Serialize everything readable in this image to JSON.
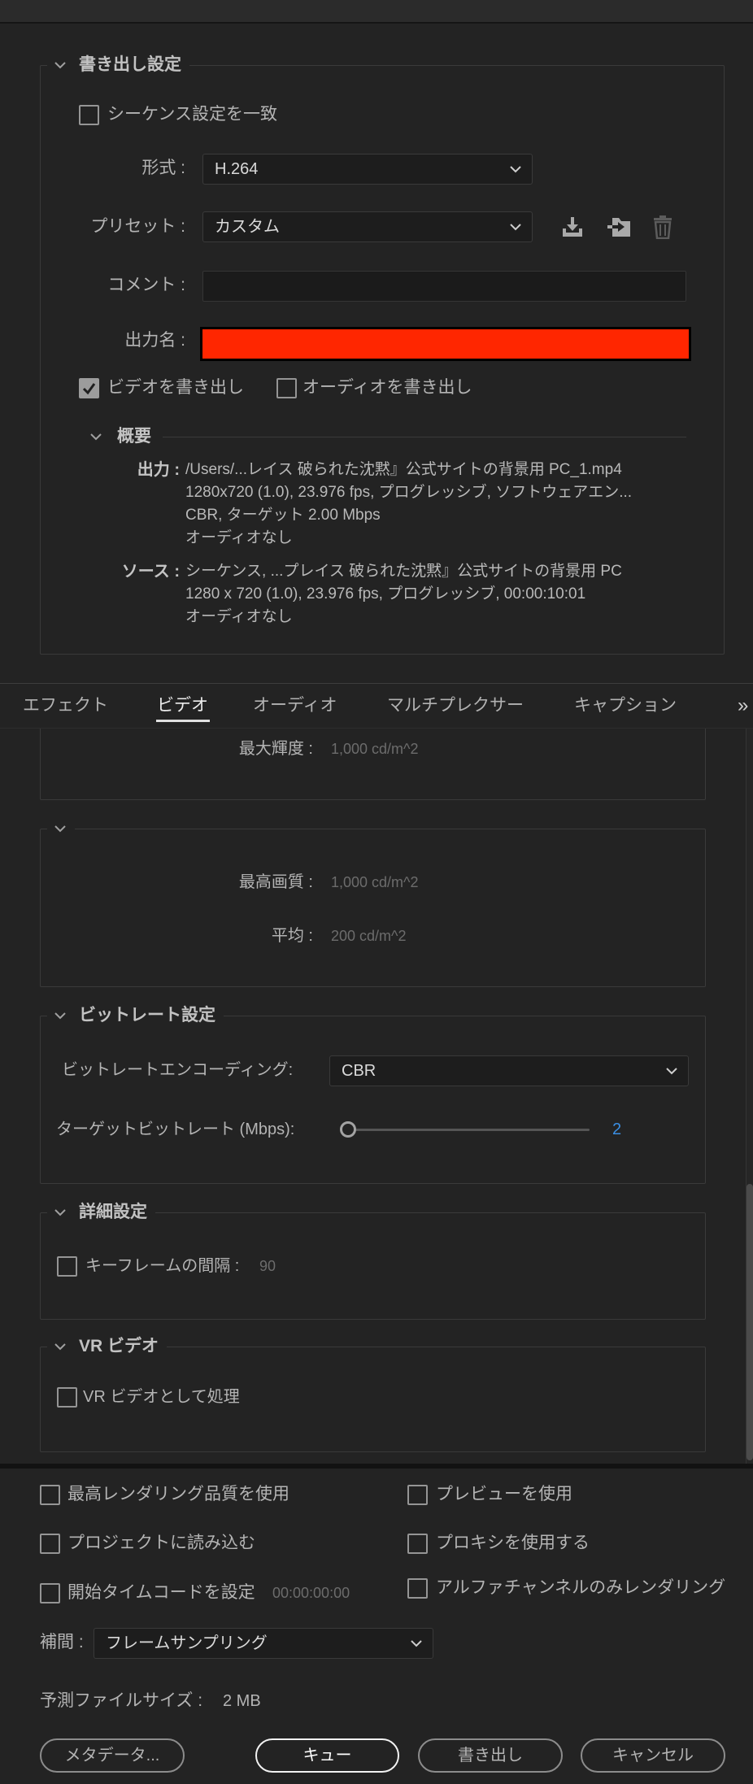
{
  "colors": {
    "output_name_fill": "#ff2600",
    "bitrate_value": "#3b8fe3",
    "active_tab_underline": "#e0e0e0"
  },
  "export_settings": {
    "title": "書き出し設定",
    "match_sequence": {
      "label": "シーケンス設定を一致",
      "checked": false
    },
    "format": {
      "label": "形式 :",
      "value": "H.264"
    },
    "preset": {
      "label": "プリセット :",
      "value": "カスタム",
      "icons": [
        "download-icon",
        "folder-import-icon",
        "trash-icon"
      ]
    },
    "comment": {
      "label": "コメント :"
    },
    "output_name": {
      "label": "出力名 :"
    },
    "export_video": {
      "label": "ビデオを書き出し",
      "checked": true
    },
    "export_audio": {
      "label": "オーディオを書き出し",
      "checked": false
    },
    "summary": {
      "title": "概要",
      "output_label": "出力 :",
      "output_lines": [
        "/Users/...レイス 破られた沈黙』公式サイトの背景用 PC_1.mp4",
        "1280x720 (1.0), 23.976 fps, プログレッシブ, ソフトウェアエン...",
        "CBR, ターゲット 2.00 Mbps",
        "オーディオなし"
      ],
      "source_label": "ソース :",
      "source_lines": [
        "シーケンス, ...プレイス 破られた沈黙』公式サイトの背景用 PC",
        "1280 x 720 (1.0), 23.976 fps, プログレッシブ, 00:00:10:01",
        "オーディオなし"
      ]
    }
  },
  "tabs": [
    {
      "label": "エフェクト",
      "active": false
    },
    {
      "label": "ビデオ",
      "active": true
    },
    {
      "label": "オーディオ",
      "active": false
    },
    {
      "label": "マルチプレクサー",
      "active": false
    },
    {
      "label": "キャプション",
      "active": false
    }
  ],
  "tab_overflow": "»",
  "video": {
    "max_luminance": {
      "label": "最大輝度 :",
      "value": "1,000 cd/m^2"
    },
    "hdr_group": {
      "highest_quality": {
        "label": "最高画質 :",
        "value": "1,000 cd/m^2"
      },
      "average": {
        "label": "平均 :",
        "value": "200 cd/m^2"
      }
    },
    "bitrate": {
      "title": "ビットレート設定",
      "encoding": {
        "label": "ビットレートエンコーディング:",
        "value": "CBR"
      },
      "target": {
        "label": "ターゲットビットレート (Mbps):",
        "value": "2"
      }
    },
    "advanced": {
      "title": "詳細設定",
      "keyframe": {
        "label": "キーフレームの間隔 :",
        "value": "90",
        "checked": false
      }
    },
    "vr": {
      "title": "VR ビデオ",
      "process_as_vr": {
        "label": "VR ビデオとして処理",
        "checked": false
      }
    }
  },
  "options": {
    "max_render_quality": {
      "label": "最高レンダリング品質を使用",
      "checked": false
    },
    "use_previews": {
      "label": "プレビューを使用",
      "checked": false
    },
    "import_into_project": {
      "label": "プロジェクトに読み込む",
      "checked": false
    },
    "use_proxies": {
      "label": "プロキシを使用する",
      "checked": false
    },
    "start_timecode": {
      "label": "開始タイムコードを設定",
      "value": "00:00:00:00",
      "checked": false
    },
    "alpha_only": {
      "label": "アルファチャンネルのみレンダリング",
      "checked": false
    },
    "interpolation": {
      "label": "補間 :",
      "value": "フレームサンプリング"
    },
    "estimated_size": {
      "label": "予測ファイルサイズ :",
      "value": "2 MB"
    }
  },
  "buttons": {
    "metadata": "メタデータ...",
    "queue": "キュー",
    "export": "書き出し",
    "cancel": "キャンセル"
  }
}
